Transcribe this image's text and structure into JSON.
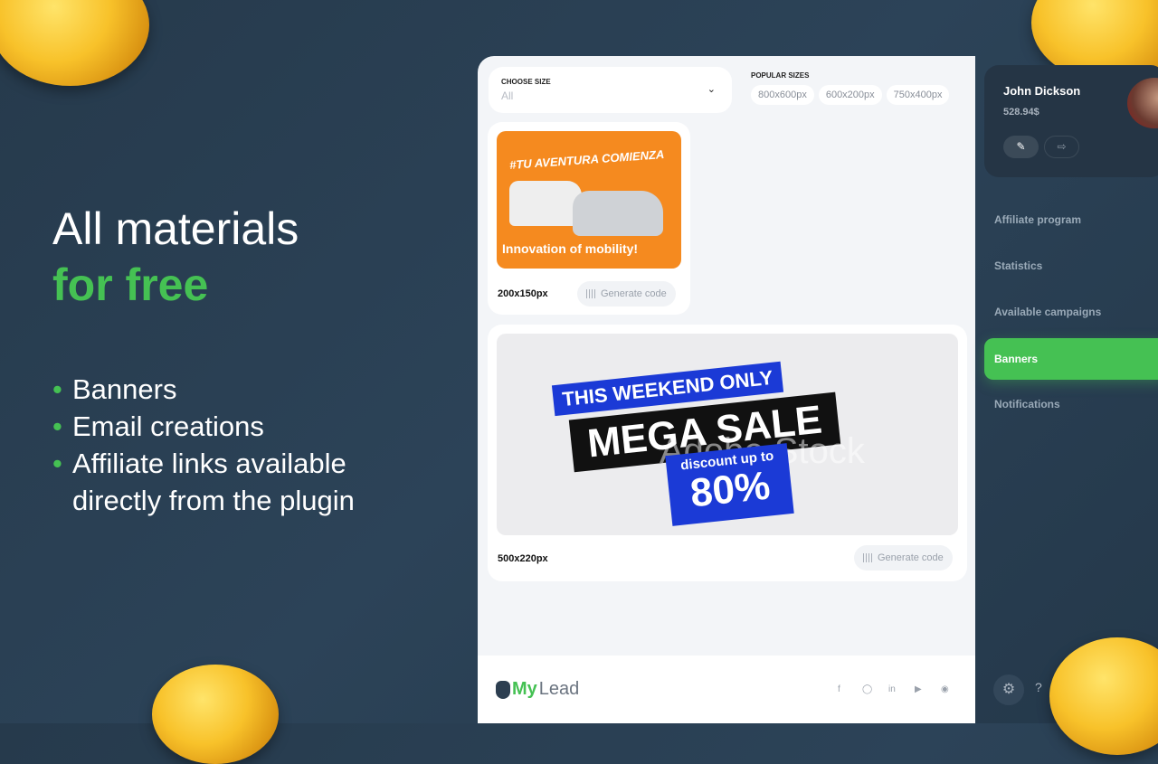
{
  "promo": {
    "line1": "All materials",
    "line2": "for free",
    "bullets": [
      "Banners",
      "Email creations",
      "Affiliate links available",
      "directly from the plugin"
    ]
  },
  "filter": {
    "choose_label": "CHOOSE SIZE",
    "choose_value": "All",
    "popular_label": "POPULAR SIZES",
    "popular": [
      "800x600px",
      "600x200px",
      "750x400px"
    ]
  },
  "banners": [
    {
      "size": "200x150px",
      "generate": "Generate code",
      "headline": "#TU AVENTURA COMIENZA",
      "tagline": "Innovation of mobility!"
    },
    {
      "size": "500x220px",
      "generate": "Generate code",
      "line1": "THIS WEEKEND ONLY",
      "line2": "MEGA SALE",
      "line3": "discount up to",
      "line4": "80%",
      "watermark": "Adobe Stock"
    }
  ],
  "footer": {
    "logo_my": "My",
    "logo_lead": "Lead",
    "social": [
      "facebook-icon",
      "instagram-icon",
      "linkedin-icon",
      "youtube-icon",
      "discord-icon"
    ]
  },
  "profile": {
    "name": "John Dickson",
    "balance": "528.94$"
  },
  "nav": [
    {
      "label": "Affiliate program"
    },
    {
      "label": "Statistics"
    },
    {
      "label": "Available campaigns"
    },
    {
      "label": "Banners",
      "active": true
    },
    {
      "label": "Notifications"
    }
  ],
  "colors": {
    "accent": "#45c153",
    "background": "#263a4c"
  }
}
